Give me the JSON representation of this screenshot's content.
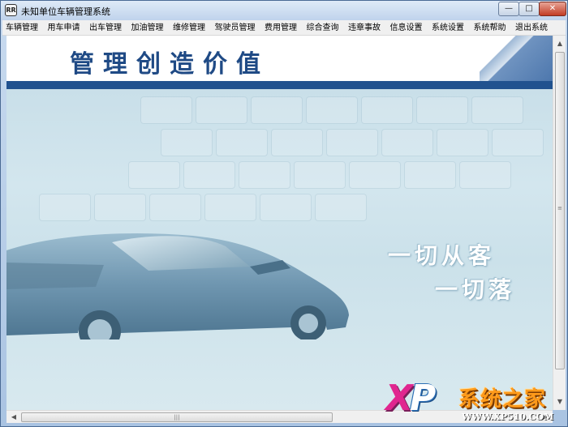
{
  "window": {
    "title": "未知单位车辆管理系统",
    "icon_text": "RR",
    "controls": {
      "minimize": "—",
      "maximize": "□",
      "close": "✕"
    }
  },
  "menu": {
    "items": [
      {
        "label": "车辆管理"
      },
      {
        "label": "用车申请"
      },
      {
        "label": "出车管理"
      },
      {
        "label": "加油管理"
      },
      {
        "label": "维修管理"
      },
      {
        "label": "驾驶员管理"
      },
      {
        "label": "费用管理"
      },
      {
        "label": "综合查询"
      },
      {
        "label": "违章事故"
      },
      {
        "label": "信息设置"
      },
      {
        "label": "系统设置"
      },
      {
        "label": "系统帮助"
      },
      {
        "label": "退出系统"
      }
    ]
  },
  "banner": {
    "title": "管理创造价值",
    "band_color": "#21528f"
  },
  "slogan": {
    "line1": "一切从客",
    "line2": "一切落"
  },
  "scrollbars": {
    "up": "▲",
    "down": "▼",
    "left": "◀",
    "right": "▶",
    "grip": "|||"
  },
  "watermark": {
    "xp_x": "X",
    "xp_p": "P",
    "brand": "系统之家",
    "url": "WWW.XP510.COM"
  },
  "colors": {
    "accent": "#21528f",
    "client_bg": "#cbe1ea"
  }
}
